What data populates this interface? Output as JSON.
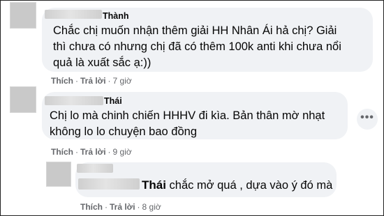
{
  "comments": [
    {
      "author": "Thành",
      "text_lines": [
        "Chắc chị muốn nhận thêm giải HH Nhân Ái hả chị? Giải",
        "thì chưa có nhưng chị đã có thêm 100k anti khi chưa nổi",
        "quả là xuất sắc ạ:))"
      ],
      "like_label": "Thích",
      "reply_label": "Trả lời",
      "time": "7 giờ"
    },
    {
      "author": "Thái",
      "text_lines": [
        "Chị lo mà chinh chiến HHHV đi kìa. Bản thân mờ nhạt",
        "không lo lo chuyện bao đồng"
      ],
      "like_label": "Thích",
      "reply_label": "Trả lời",
      "time": "9 giờ",
      "more_icon": "more-horizontal-icon"
    },
    {
      "mention": "Thái",
      "text": "chắc mở quá , dựa vào ý đó mà",
      "like_label": "Thích",
      "reply_label": "Trả lời",
      "time": "8 giờ"
    }
  ],
  "separator": "·",
  "more_glyph": "•••"
}
